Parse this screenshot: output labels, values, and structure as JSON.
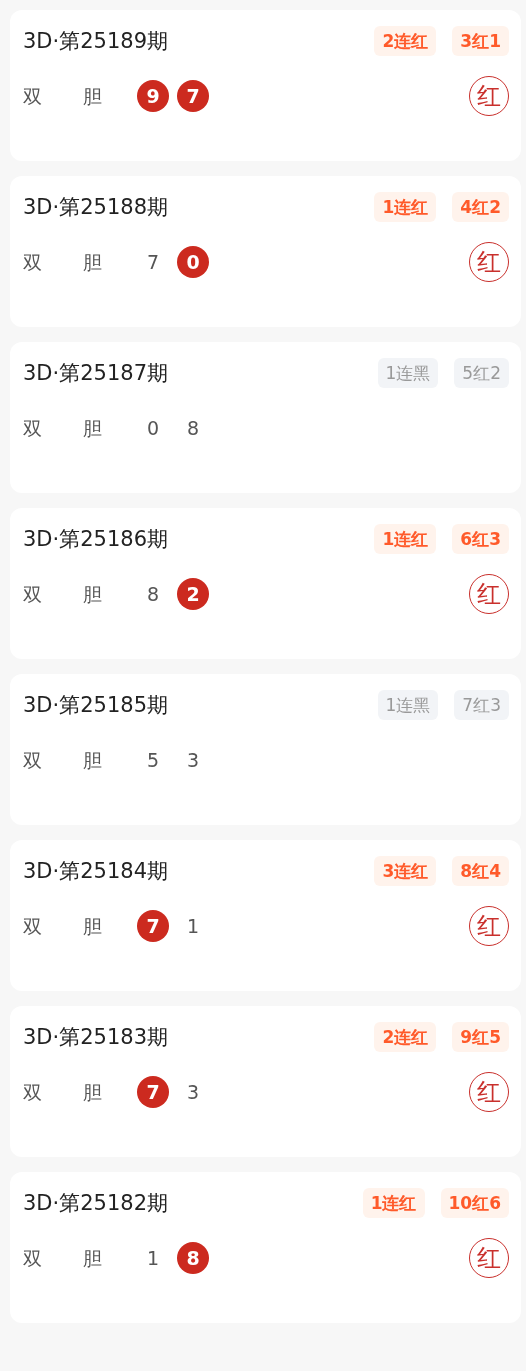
{
  "draws": [
    {
      "title": "3D·第25189期",
      "hit": true,
      "tags": [
        "2连红",
        "3红1"
      ],
      "labels": [
        "双",
        "胆"
      ],
      "digits": [
        {
          "value": "9",
          "hit": true
        },
        {
          "value": "7",
          "hit": true
        }
      ],
      "stamp": "红"
    },
    {
      "title": "3D·第25188期",
      "hit": true,
      "tags": [
        "1连红",
        "4红2"
      ],
      "labels": [
        "双",
        "胆"
      ],
      "digits": [
        {
          "value": "7",
          "hit": false
        },
        {
          "value": "0",
          "hit": true
        }
      ],
      "stamp": "红"
    },
    {
      "title": "3D·第25187期",
      "hit": false,
      "tags": [
        "1连黑",
        "5红2"
      ],
      "labels": [
        "双",
        "胆"
      ],
      "digits": [
        {
          "value": "0",
          "hit": false
        },
        {
          "value": "8",
          "hit": false
        }
      ]
    },
    {
      "title": "3D·第25186期",
      "hit": true,
      "tags": [
        "1连红",
        "6红3"
      ],
      "labels": [
        "双",
        "胆"
      ],
      "digits": [
        {
          "value": "8",
          "hit": false
        },
        {
          "value": "2",
          "hit": true
        }
      ],
      "stamp": "红"
    },
    {
      "title": "3D·第25185期",
      "hit": false,
      "tags": [
        "1连黑",
        "7红3"
      ],
      "labels": [
        "双",
        "胆"
      ],
      "digits": [
        {
          "value": "5",
          "hit": false
        },
        {
          "value": "3",
          "hit": false
        }
      ]
    },
    {
      "title": "3D·第25184期",
      "hit": true,
      "tags": [
        "3连红",
        "8红4"
      ],
      "labels": [
        "双",
        "胆"
      ],
      "digits": [
        {
          "value": "7",
          "hit": true
        },
        {
          "value": "1",
          "hit": false
        }
      ],
      "stamp": "红"
    },
    {
      "title": "3D·第25183期",
      "hit": true,
      "tags": [
        "2连红",
        "9红5"
      ],
      "labels": [
        "双",
        "胆"
      ],
      "digits": [
        {
          "value": "7",
          "hit": true
        },
        {
          "value": "3",
          "hit": false
        }
      ],
      "stamp": "红"
    },
    {
      "title": "3D·第25182期",
      "hit": true,
      "tags": [
        "1连红",
        "10红6"
      ],
      "labels": [
        "双",
        "胆"
      ],
      "digits": [
        {
          "value": "1",
          "hit": false
        },
        {
          "value": "8",
          "hit": true
        }
      ],
      "stamp": "红"
    }
  ]
}
